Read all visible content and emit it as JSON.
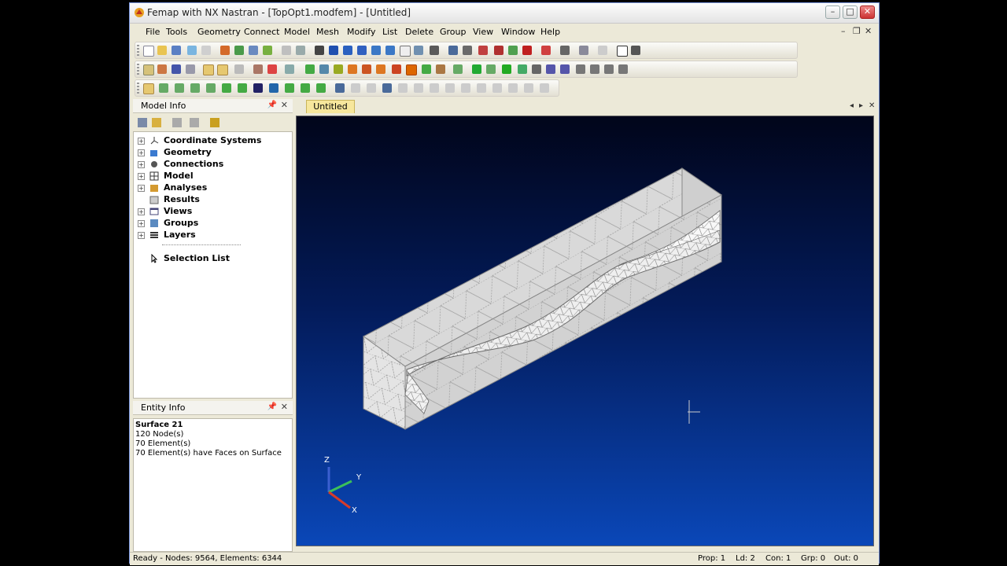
{
  "window": {
    "title": "Femap with NX Nastran - [TopOpt1.modfem] - [Untitled]",
    "minimize": "–",
    "maximize": "□",
    "close": "✕"
  },
  "menu": {
    "items": [
      "File",
      "Tools",
      "Geometry",
      "Connect",
      "Model",
      "Mesh",
      "Modify",
      "List",
      "Delete",
      "Group",
      "View",
      "Window",
      "Help"
    ],
    "mdi_min": "–",
    "mdi_restore": "❐",
    "mdi_close": "✕"
  },
  "model_info": {
    "title": "Model Info",
    "pin": "📌",
    "close": "✕",
    "tree": [
      {
        "label": "Coordinate Systems",
        "icon": "coordinate-system-icon",
        "expandable": true
      },
      {
        "label": "Geometry",
        "icon": "geometry-icon",
        "expandable": true
      },
      {
        "label": "Connections",
        "icon": "connections-icon",
        "expandable": true
      },
      {
        "label": "Model",
        "icon": "model-icon",
        "expandable": true
      },
      {
        "label": "Analyses",
        "icon": "analyses-icon",
        "expandable": true
      },
      {
        "label": "Results",
        "icon": "results-icon",
        "expandable": false
      },
      {
        "label": "Views",
        "icon": "views-icon",
        "expandable": true
      },
      {
        "label": "Groups",
        "icon": "groups-icon",
        "expandable": true
      },
      {
        "label": "Layers",
        "icon": "layers-icon",
        "expandable": true
      },
      {
        "label": "Selection List",
        "icon": "selection-list-icon",
        "expandable": false
      }
    ]
  },
  "entity_info": {
    "title": "Entity Info",
    "pin": "📌",
    "close": "✕",
    "lines": [
      "Surface 21",
      "120 Node(s)",
      "70 Element(s)",
      "70 Element(s) have Faces on Surface"
    ]
  },
  "view": {
    "tab_label": "Untitled",
    "axis_x": "X",
    "axis_y": "Y",
    "axis_z": "Z"
  },
  "status": {
    "left": "Ready - Nodes: 9564, Elements: 6344",
    "prop": "Prop: 1",
    "ld": "Ld: 2",
    "con": "Con: 1",
    "grp": "Grp: 0",
    "out": "Out: 0"
  },
  "colors": {
    "viewport_top": "#01051a",
    "viewport_bottom": "#0a47b8",
    "mesh_face": "#d8d8d8",
    "tab_active": "#f7e79c"
  }
}
